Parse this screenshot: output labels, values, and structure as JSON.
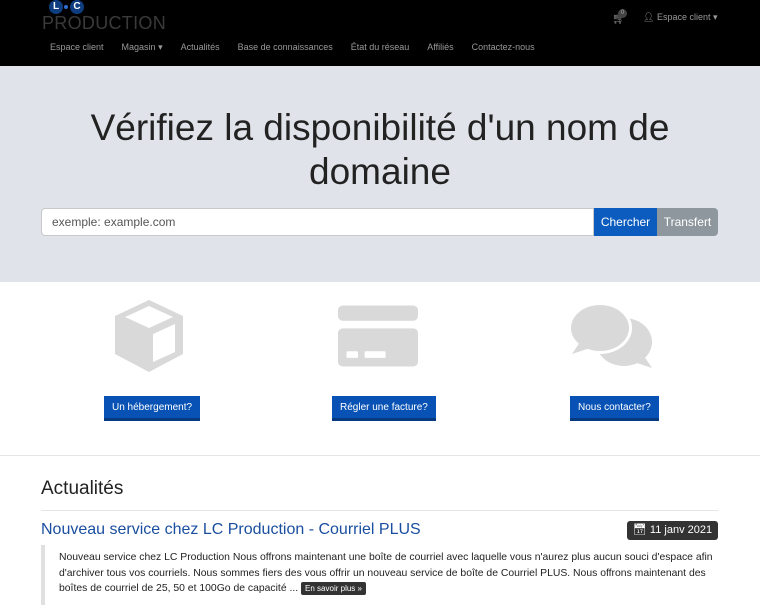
{
  "header": {
    "logo_letters": [
      "L",
      "C"
    ],
    "logo_text": "PRODUCTION",
    "cart_count": "0",
    "account_label": "Espace client"
  },
  "nav": [
    "Espace client",
    "Magasin",
    "Actualités",
    "Base de connaissances",
    "État du réseau",
    "Affiliés",
    "Contactez-nous"
  ],
  "hero": {
    "title": "Vérifiez la disponibilité d'un nom de domaine",
    "search_placeholder": "exemple: example.com",
    "search_button": "Chercher",
    "transfer_button": "Transfert"
  },
  "features": [
    {
      "icon": "cube-icon",
      "label": "Un hébergement?"
    },
    {
      "icon": "credit-card-icon",
      "label": "Régler une facture?"
    },
    {
      "icon": "comments-icon",
      "label": "Nous contacter?"
    }
  ],
  "news": {
    "heading": "Actualités",
    "items": [
      {
        "title": "Nouveau service chez LC Production - Courriel PLUS",
        "date": "11 janv 2021",
        "excerpt": "Nouveau service chez LC Production Nous offrons maintenant une boîte de courriel avec laquelle vous n'aurez plus aucun souci d'espace afin d'archiver tous vos courriels. Nous sommes fiers des vous offrir un nouveau service de boîte de Courriel PLUS. Nous offrons maintenant des boîtes de courriel de 25, 50 et 100Go de capacité ...",
        "more": "En savoir plus »"
      }
    ]
  },
  "colors": {
    "primary": "#0852b5",
    "header": "#000000",
    "hero": "#e0e3ea"
  }
}
